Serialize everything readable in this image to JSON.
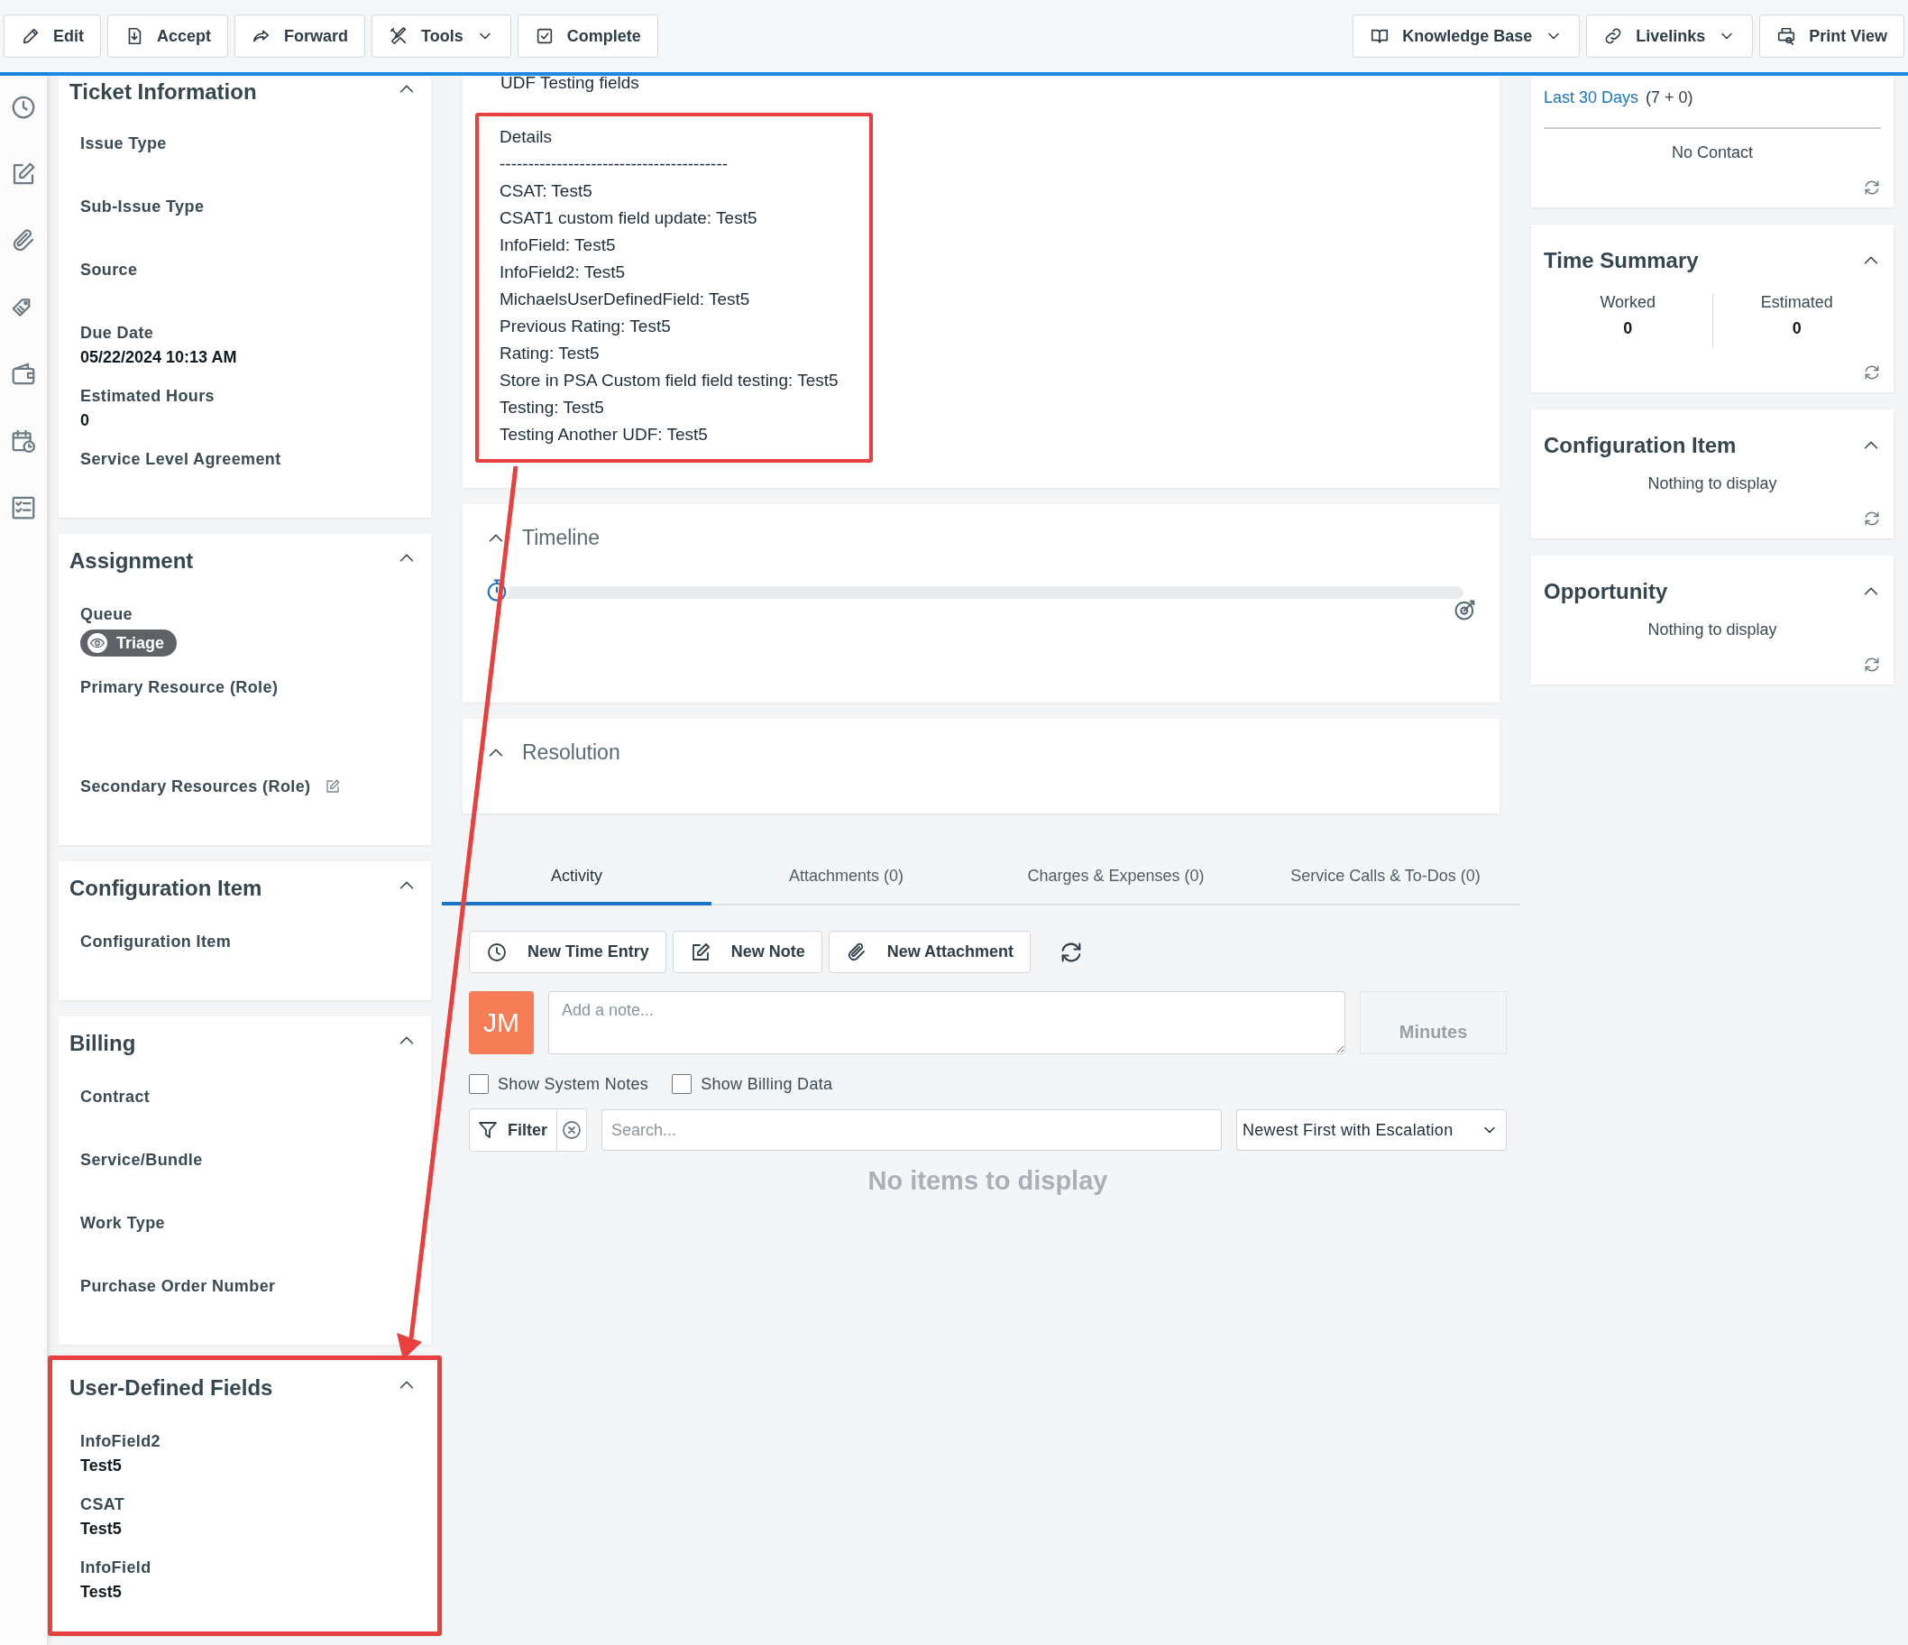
{
  "toolbar": {
    "left": [
      {
        "label": "Edit",
        "dropdown": false
      },
      {
        "label": "Accept",
        "dropdown": false
      },
      {
        "label": "Forward",
        "dropdown": false
      },
      {
        "label": "Tools",
        "dropdown": true
      },
      {
        "label": "Complete",
        "dropdown": false
      }
    ],
    "right": [
      {
        "label": "Knowledge Base",
        "dropdown": true
      },
      {
        "label": "Livelinks",
        "dropdown": true
      },
      {
        "label": "Print View",
        "dropdown": false
      }
    ]
  },
  "left_panels": [
    {
      "title": "Ticket Information",
      "expanded": true,
      "highlighted": false,
      "fields": [
        {
          "kind": "text",
          "label": "Issue Type"
        },
        {
          "kind": "text",
          "label": "Sub-Issue Type"
        },
        {
          "kind": "text",
          "label": "Source"
        },
        {
          "kind": "text",
          "label": "Due Date",
          "value": "05/22/2024 10:13 AM"
        },
        {
          "kind": "text",
          "label": "Estimated Hours",
          "value": "0"
        },
        {
          "kind": "text",
          "label": "Service Level Agreement"
        }
      ]
    },
    {
      "title": "Assignment",
      "expanded": true,
      "highlighted": false,
      "fields": [
        {
          "kind": "badge",
          "label": "Queue",
          "value": "Triage"
        },
        {
          "kind": "tall",
          "label": "Primary Resource (Role)"
        },
        {
          "kind": "editable",
          "label": "Secondary Resources (Role)"
        }
      ]
    },
    {
      "title": "Configuration Item",
      "expanded": true,
      "highlighted": false,
      "fields": [
        {
          "kind": "text",
          "label": "Configuration Item"
        }
      ]
    },
    {
      "title": "Billing",
      "expanded": true,
      "highlighted": false,
      "fields": [
        {
          "kind": "text",
          "label": "Contract"
        },
        {
          "kind": "text",
          "label": "Service/Bundle"
        },
        {
          "kind": "text",
          "label": "Work Type"
        },
        {
          "kind": "text",
          "label": "Purchase Order Number"
        }
      ]
    },
    {
      "title": "User-Defined Fields",
      "expanded": true,
      "highlighted": true,
      "fields": [
        {
          "kind": "text",
          "label": "InfoField2",
          "value": "Test5"
        },
        {
          "kind": "text",
          "label": "CSAT",
          "value": "Test5"
        },
        {
          "kind": "text",
          "label": "InfoField",
          "value": "Test5"
        }
      ]
    }
  ],
  "description": {
    "text": "UDF Testing fields",
    "details": {
      "highlighted": true,
      "title": "Details",
      "separator": "----------------------------------------",
      "lines": [
        "CSAT: Test5",
        "CSAT1 custom field update: Test5",
        "InfoField: Test5",
        "InfoField2: Test5",
        "MichaelsUserDefinedField: Test5",
        "Previous Rating: Test5",
        "Rating: Test5",
        "Store in PSA Custom field field testing: Test5",
        "Testing: Test5",
        "Testing Another UDF: Test5"
      ]
    }
  },
  "timeline": {
    "title": "Timeline",
    "expanded": true
  },
  "resolution": {
    "title": "Resolution",
    "expanded": true
  },
  "activity": {
    "tabs": [
      {
        "label": "Activity",
        "selected": true
      },
      {
        "label": "Attachments (0)",
        "selected": false
      },
      {
        "label": "Charges & Expenses (0)",
        "selected": false
      },
      {
        "label": "Service Calls & To-Dos (0)",
        "selected": false
      }
    ],
    "actions": [
      "New Time Entry",
      "New Note",
      "New Attachment"
    ],
    "avatar": "JM",
    "note_placeholder": "Add a note...",
    "minutes_placeholder": "Minutes",
    "checkboxes": [
      {
        "label": "Show System Notes",
        "checked": false
      },
      {
        "label": "Show Billing Data",
        "checked": false
      }
    ],
    "filter": "Filter",
    "search_placeholder": "Search...",
    "sort": "Newest First with Escalation",
    "empty": "No items to display"
  },
  "right_panels": [
    {
      "kind": "contact",
      "link": "Last 30 Days",
      "count": "(7 + 0)",
      "empty": "No Contact"
    },
    {
      "kind": "time",
      "title": "Time Summary",
      "expanded": true,
      "stats": [
        {
          "label": "Worked",
          "value": "0"
        },
        {
          "label": "Estimated",
          "value": "0"
        }
      ]
    },
    {
      "kind": "empty",
      "title": "Configuration Item",
      "expanded": true,
      "empty": "Nothing to display"
    },
    {
      "kind": "empty",
      "title": "Opportunity",
      "expanded": true,
      "empty": "Nothing to display"
    }
  ]
}
